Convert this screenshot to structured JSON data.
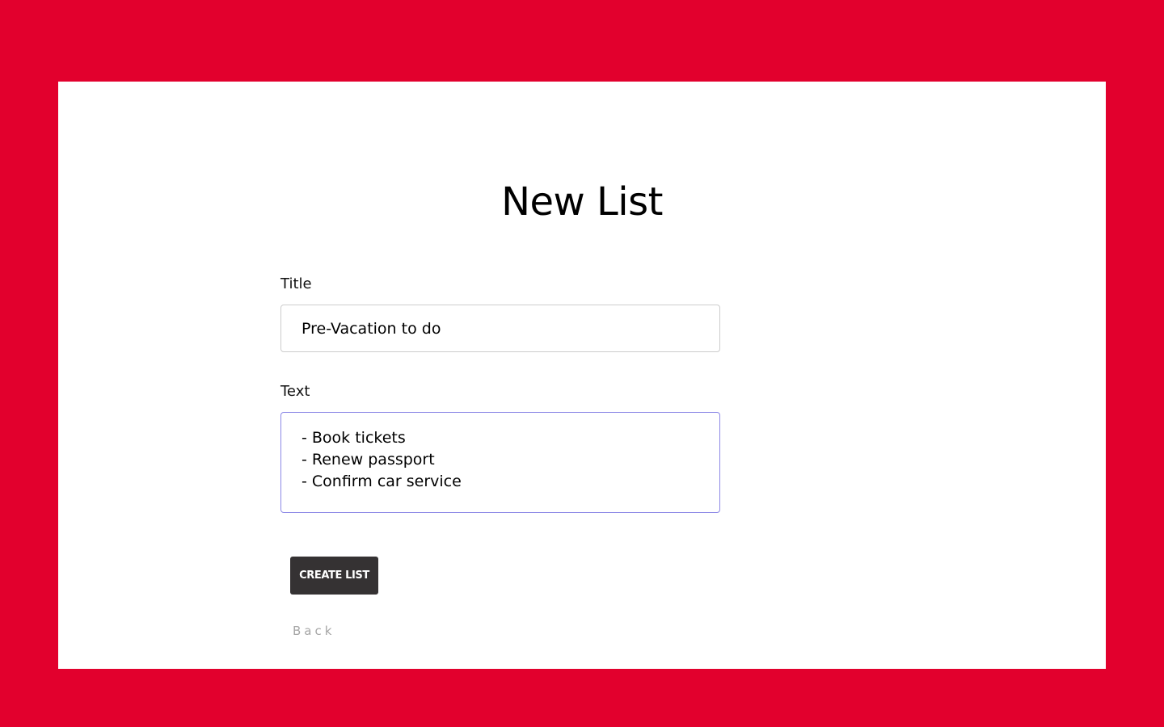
{
  "page": {
    "title": "New List",
    "background_color": "#e2002d",
    "card_color": "#ffffff"
  },
  "form": {
    "title_label": "Title",
    "title_value": "Pre-Vacation to do",
    "text_label": "Text",
    "text_value": "- Book tickets\n- Renew passport\n- Confirm car service",
    "submit_label": "CREATE LIST",
    "submit_color": "#353233",
    "focus_border_color": "#8c88e6"
  },
  "nav": {
    "back_label": "Back"
  }
}
